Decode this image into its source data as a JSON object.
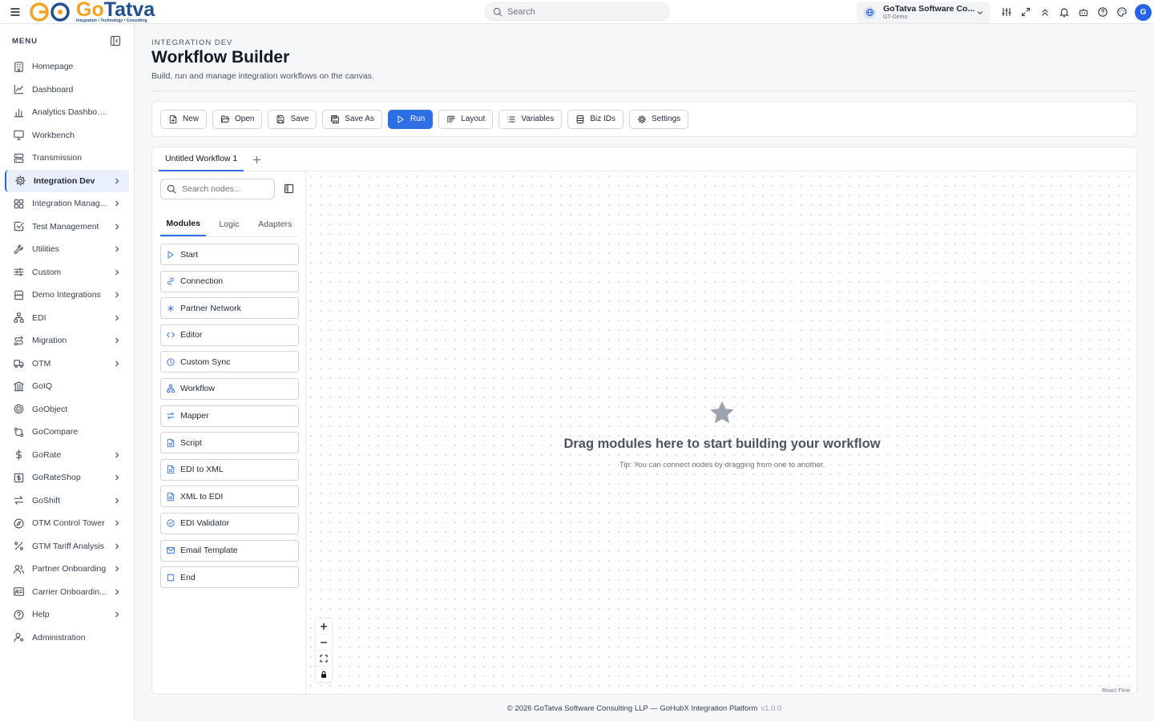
{
  "brand": {
    "logo_name_a": "Go",
    "logo_name_b": "Tatva",
    "tagline": "Integration • Technology • Consulting"
  },
  "search": {
    "placeholder": "Search"
  },
  "org": {
    "name": "GoTatva Software Co...",
    "sub": "GT-Demo"
  },
  "user": {
    "initial": "G"
  },
  "top_icons": [
    "sliders-icon",
    "expand-icon",
    "chevrons-up-icon",
    "bell-icon",
    "bot-icon",
    "help-icon",
    "palette-icon"
  ],
  "sidebar": {
    "header": "MENU",
    "items": [
      {
        "label": "Homepage",
        "icon": "building-icon",
        "chevron": false
      },
      {
        "label": "Dashboard",
        "icon": "line-chart-icon",
        "chevron": false
      },
      {
        "label": "Analytics Dashboard",
        "icon": "bar-chart-icon",
        "chevron": false
      },
      {
        "label": "Workbench",
        "icon": "monitor-icon",
        "chevron": false
      },
      {
        "label": "Transmission",
        "icon": "server-icon",
        "chevron": false
      },
      {
        "label": "Integration Dev",
        "icon": "gear-icon",
        "chevron": true,
        "active": true
      },
      {
        "label": "Integration Manag...",
        "icon": "grid-icon",
        "chevron": true
      },
      {
        "label": "Test Management",
        "icon": "check-square-icon",
        "chevron": true
      },
      {
        "label": "Utilities",
        "icon": "wrench-icon",
        "chevron": true
      },
      {
        "label": "Custom",
        "icon": "sliders-icon",
        "chevron": true
      },
      {
        "label": "Demo Integrations",
        "icon": "store-icon",
        "chevron": true
      },
      {
        "label": "EDI",
        "icon": "network-icon",
        "chevron": true
      },
      {
        "label": "Migration",
        "icon": "route-icon",
        "chevron": true
      },
      {
        "label": "OTM",
        "icon": "truck-icon",
        "chevron": true
      },
      {
        "label": "GoIQ",
        "icon": "library-icon",
        "chevron": false
      },
      {
        "label": "GoObject",
        "icon": "target-icon",
        "chevron": false
      },
      {
        "label": "GoCompare",
        "icon": "git-compare-icon",
        "chevron": false
      },
      {
        "label": "GoRate",
        "icon": "dollar-icon",
        "chevron": true
      },
      {
        "label": "GoRateShop",
        "icon": "receipt-icon",
        "chevron": true
      },
      {
        "label": "GoShift",
        "icon": "arrows-icon",
        "chevron": true
      },
      {
        "label": "OTM Control Tower",
        "icon": "compass-icon",
        "chevron": true
      },
      {
        "label": "GTM Tariff Analysis",
        "icon": "percent-icon",
        "chevron": true
      },
      {
        "label": "Partner Onboarding",
        "icon": "users-icon",
        "chevron": true
      },
      {
        "label": "Carrier Onboardin...",
        "icon": "id-card-icon",
        "chevron": true
      },
      {
        "label": "Help",
        "icon": "help-circle-icon",
        "chevron": true
      },
      {
        "label": "Administration",
        "icon": "user-cog-icon",
        "chevron": false
      }
    ]
  },
  "page": {
    "breadcrumb": "INTEGRATION DEV",
    "title": "Workflow Builder",
    "subtitle": "Build, run and manage integration workflows on the canvas."
  },
  "toolbar": [
    {
      "label": "New",
      "icon": "file-plus-icon"
    },
    {
      "label": "Open",
      "icon": "folder-open-icon"
    },
    {
      "label": "Save",
      "icon": "save-icon"
    },
    {
      "label": "Save As",
      "icon": "save-all-icon"
    },
    {
      "label": "Run",
      "icon": "play-icon",
      "primary": true
    },
    {
      "label": "Layout",
      "icon": "layout-icon"
    },
    {
      "label": "Variables",
      "icon": "list-icon"
    },
    {
      "label": "Biz IDs",
      "icon": "database-icon"
    },
    {
      "label": "Settings",
      "icon": "gear-icon"
    }
  ],
  "workflow_tabs": [
    {
      "label": "Untitled Workflow 1"
    }
  ],
  "palette": {
    "search_placeholder": "Search nodes...",
    "tabs": [
      "Modules",
      "Logic",
      "Adapters"
    ],
    "active_tab": "Modules",
    "modules": [
      {
        "label": "Start",
        "icon": "play-icon"
      },
      {
        "label": "Connection",
        "icon": "link-icon"
      },
      {
        "label": "Partner Network",
        "icon": "asterisk-icon"
      },
      {
        "label": "Editor",
        "icon": "code-icon"
      },
      {
        "label": "Custom Sync",
        "icon": "clock-icon"
      },
      {
        "label": "Workflow",
        "icon": "workflow-icon"
      },
      {
        "label": "Mapper",
        "icon": "arrows-icon"
      },
      {
        "label": "Script",
        "icon": "file-text-icon"
      },
      {
        "label": "EDI to XML",
        "icon": "file-text-icon"
      },
      {
        "label": "XML to EDI",
        "icon": "file-text-icon"
      },
      {
        "label": "EDI Validator",
        "icon": "check-circle-icon"
      },
      {
        "label": "Email Template",
        "icon": "mail-icon"
      },
      {
        "label": "End",
        "icon": "square-icon"
      }
    ]
  },
  "canvas": {
    "empty_title": "Drag modules here to start building your workflow",
    "empty_tip": "Tip: You can connect nodes by dragging from one to another.",
    "attribution": "React Flow",
    "controls": [
      "zoom-in-icon",
      "zoom-out-icon",
      "fit-view-icon",
      "lock-icon"
    ]
  },
  "footer": {
    "text": "© 2026 GoTatva Software Consulting LLP — GoHubX Integration Platform",
    "version": "v1.0.0"
  },
  "colors": {
    "accent": "#2f6fe4",
    "brand_orange": "#f6a21e",
    "brand_blue": "#1d4f91",
    "active_bg": "#eaf0fb"
  }
}
